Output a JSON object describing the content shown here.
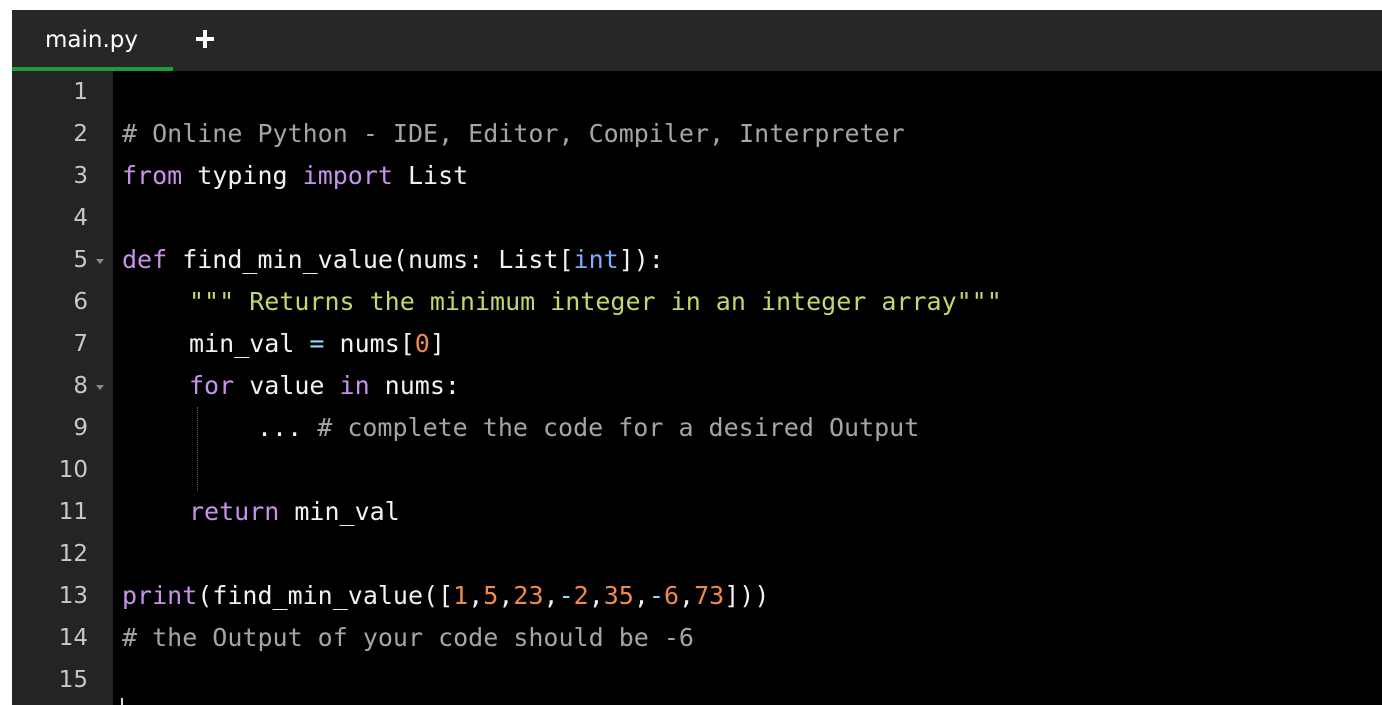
{
  "editor": {
    "tab": {
      "label": "main.py"
    },
    "add_tab_icon": "plus-icon",
    "line_numbers": [
      "1",
      "2",
      "3",
      "4",
      "5",
      "6",
      "7",
      "8",
      "9",
      "10",
      "11",
      "12",
      "13",
      "14",
      "15"
    ],
    "fold_icon": "chevron-down-icon",
    "code": {
      "l2_comment": "# Online Python - IDE, Editor, Compiler, Interpreter",
      "l3_from": "from",
      "l3_module": " typing ",
      "l3_import": "import",
      "l3_name": " List",
      "l5_def": "def",
      "l5_fn": " find_min_value(nums: List[",
      "l5_int": "int",
      "l5_end": "]):",
      "l6_docstring": "\"\"\" Returns the minimum integer in an integer array\"\"\"",
      "l7_name": "min_val ",
      "l7_eq": "=",
      "l7_rhs": " nums[",
      "l7_zero": "0",
      "l7_close": "]",
      "l8_for": "for",
      "l8_var": " value ",
      "l8_in": "in",
      "l8_rest": " nums:",
      "l9_ellipsis": "... ",
      "l9_comment": "# complete the code for a desired Output",
      "l11_return": "return",
      "l11_rest": " min_val",
      "l13_print": "print",
      "l13_call": "(find_min_value([",
      "l13_n1": "1",
      "l13_c1": ",",
      "l13_n2": "5",
      "l13_c2": ",",
      "l13_n3": "23",
      "l13_c3": ",",
      "l13_m3": "-",
      "l13_n4": "2",
      "l13_c4": ",",
      "l13_n5": "35",
      "l13_c5": ",",
      "l13_m5": "-",
      "l13_n6": "6",
      "l13_c6": ",",
      "l13_n7": "73",
      "l13_end": "]))",
      "l14_comment": "# the Output of your code should be -6"
    }
  },
  "colors": {
    "background": "#000000",
    "gutter": "#242424",
    "tabbar": "#272727",
    "tab_underline": "#1f9d3a",
    "keyword": "#c792ea",
    "comment": "#a5a5a5",
    "string": "#c3d86a",
    "number": "#ef8a4c",
    "builtin_type": "#82aaff"
  }
}
